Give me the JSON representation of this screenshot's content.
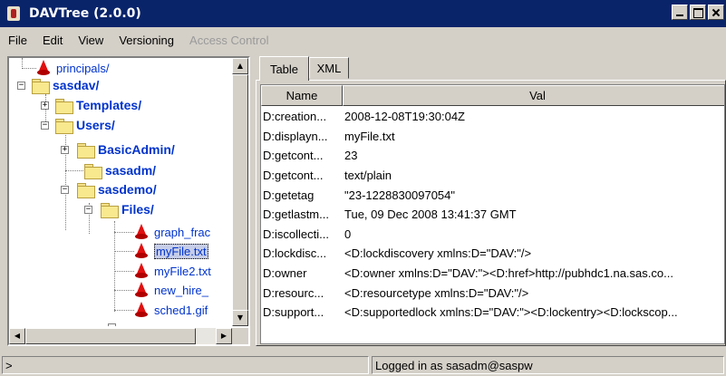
{
  "window": {
    "title": "DAVTree (2.0.0)"
  },
  "menu": {
    "items": [
      "File",
      "Edit",
      "View",
      "Versioning"
    ],
    "disabled_item": "Access Control"
  },
  "tree": {
    "rows": [
      {
        "label": "principals/",
        "icon": "resource-icon",
        "bold": false
      },
      {
        "label": "sasdav/",
        "icon": "folder-icon",
        "bold": true,
        "expander": "−"
      },
      {
        "label": "Templates/",
        "icon": "folder-icon",
        "bold": true,
        "expander": "+"
      },
      {
        "label": "Users/",
        "icon": "folder-icon",
        "bold": true,
        "expander": "−"
      },
      {
        "label": "BasicAdmin/",
        "icon": "folder-icon",
        "bold": true,
        "expander": "+"
      },
      {
        "label": "sasadm/",
        "icon": "folder-icon",
        "bold": true
      },
      {
        "label": "sasdemo/",
        "icon": "folder-icon",
        "bold": true,
        "expander": "−"
      },
      {
        "label": "Files/",
        "icon": "folder-icon",
        "bold": true,
        "expander": "−"
      },
      {
        "label": "graph_frac",
        "icon": "resource-icon",
        "bold": false
      },
      {
        "label": "myFile.txt",
        "icon": "resource-icon",
        "bold": false,
        "selected": true
      },
      {
        "label": "myFile2.txt",
        "icon": "resource-icon",
        "bold": false
      },
      {
        "label": "new_hire_",
        "icon": "resource-icon",
        "bold": false
      },
      {
        "label": "sched1.gif",
        "icon": "resource-icon",
        "bold": false
      }
    ]
  },
  "tabs": [
    {
      "label": "Table",
      "active": true
    },
    {
      "label": "XML",
      "active": false
    }
  ],
  "table": {
    "columns": [
      "Name",
      "Val"
    ],
    "rows": [
      [
        "D:creation...",
        "2008-12-08T19:30:04Z"
      ],
      [
        "D:displayn...",
        "myFile.txt"
      ],
      [
        "D:getcont...",
        "23"
      ],
      [
        "D:getcont...",
        "text/plain"
      ],
      [
        "D:getetag",
        "\"23-1228830097054\""
      ],
      [
        "D:getlastm...",
        "Tue, 09 Dec 2008 13:41:37 GMT"
      ],
      [
        "D:iscollecti...",
        "0"
      ],
      [
        "D:lockdisc...",
        "<D:lockdiscovery xmlns:D=\"DAV:\"/>"
      ],
      [
        "D:owner",
        "<D:owner xmlns:D=\"DAV:\"><D:href>http://pubhdc1.na.sas.co..."
      ],
      [
        "D:resourc...",
        "<D:resourcetype xmlns:D=\"DAV:\"/>"
      ],
      [
        "D:support...",
        "<D:supportedlock xmlns:D=\"DAV:\"><D:lockentry><D:lockscop..."
      ]
    ]
  },
  "status": {
    "prompt": ">",
    "message": "Logged in as sasadm@saspw"
  }
}
